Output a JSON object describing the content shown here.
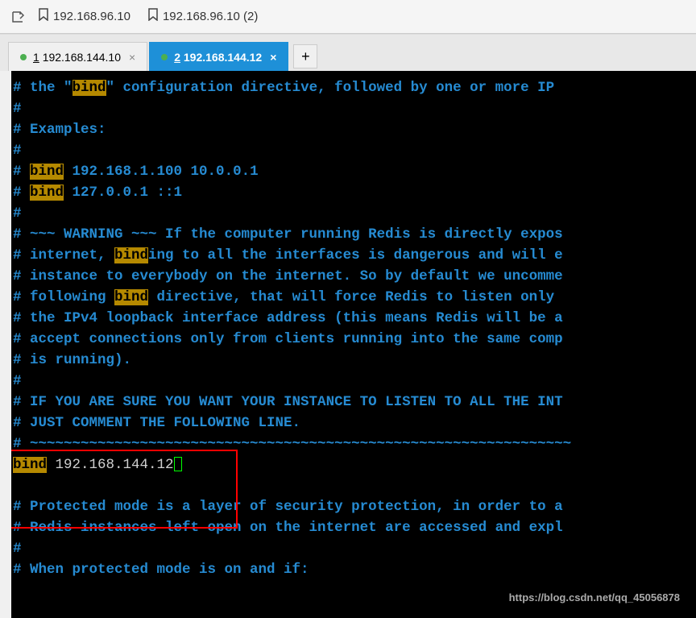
{
  "toolbar": {
    "bookmarks": [
      {
        "label": "192.168.96.10"
      },
      {
        "label": "192.168.96.10 (2)"
      }
    ]
  },
  "tabs": {
    "items": [
      {
        "num": "1",
        "label": "192.168.144.10",
        "active": false
      },
      {
        "num": "2",
        "label": "192.168.144.12",
        "active": true
      }
    ]
  },
  "terminal": {
    "l1a": "# the \"",
    "l1b": "bind",
    "l1c": "\" configuration directive, followed by one or more IP ",
    "l2": "#",
    "l3": "# Examples:",
    "l4": "#",
    "l5a": "# ",
    "l5b": "bind",
    "l5c": " 192.168.1.100 10.0.0.1",
    "l6a": "# ",
    "l6b": "bind",
    "l6c": " 127.0.0.1 ::1",
    "l7": "#",
    "l8": "# ~~~ WARNING ~~~ If the computer running Redis is directly expos",
    "l9a": "# internet, ",
    "l9b": "bind",
    "l9c": "ing to all the interfaces is dangerous and will e",
    "l10": "# instance to everybody on the internet. So by default we uncomme",
    "l11a": "# following ",
    "l11b": "bind",
    "l11c": " directive, that will force Redis to listen only ",
    "l12": "# the IPv4 loopback interface address (this means Redis will be a",
    "l13": "# accept connections only from clients running into the same comp",
    "l14": "# is running).",
    "l15": "#",
    "l16": "# IF YOU ARE SURE YOU WANT YOUR INSTANCE TO LISTEN TO ALL THE INT",
    "l17": "# JUST COMMENT THE FOLLOWING LINE.",
    "l18": "# ~~~~~~~~~~~~~~~~~~~~~~~~~~~~~~~~~~~~~~~~~~~~~~~~~~~~~~~~~~~~~~~~",
    "l19a": "bind",
    "l19b": " 192.168.144.12",
    "l20": "",
    "l21": "# Protected mode is a layer of security protection, in order to a",
    "l22": "# Redis instances left open on the internet are accessed and expl",
    "l23": "#",
    "l24": "# When protected mode is on and if:"
  },
  "watermark": "https://blog.csdn.net/qq_45056878"
}
